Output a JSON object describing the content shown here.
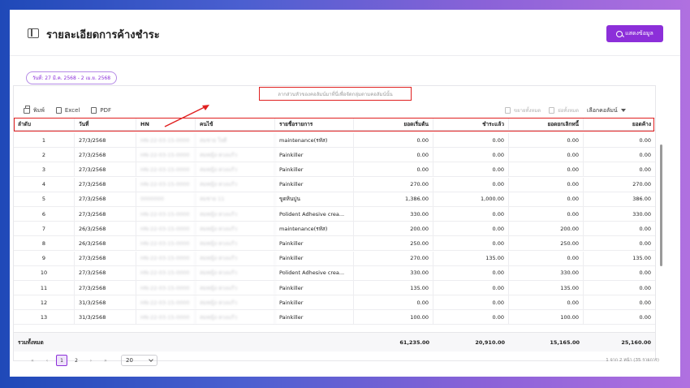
{
  "header": {
    "title": "รายละเอียดการค้างชำระ",
    "show_button": "แสดงข้อมูล"
  },
  "date_range": "วันที่: 27 มี.ค. 2568 - 2 เม.ย. 2568",
  "group_hint": "ลากส่วนหัวของคอลัมน์มาที่นี่เพื่อจัดกลุ่มตามคอลัมน์นั้น",
  "toolbar": {
    "print": "พิมพ์",
    "excel": "Excel",
    "pdf": "PDF",
    "expand_all": "ขยายทั้งหมด",
    "collapse_all": "ย่อทั้งหมด",
    "choose_columns": "เลือกคอลัมน์"
  },
  "columns": [
    "ลำดับ",
    "วันที่",
    "HN",
    "คนไข้",
    "รายชื่อรายการ",
    "ยอดเริ่มต้น",
    "ชำระแล้ว",
    "ยอดยกเลิกหนี้",
    "ยอดค้าง"
  ],
  "rows": [
    {
      "no": "1",
      "date": "27/3/2568",
      "hn": "HN-22-03-15-0000",
      "patient": "สมชาย ใจดี",
      "item": "maintenance(รหัส)",
      "start": "0.00",
      "paid": "0.00",
      "cancel": "0.00",
      "owed": "0.00"
    },
    {
      "no": "2",
      "date": "27/3/2568",
      "hn": "HN-22-03-15-0000",
      "patient": "สมหญิง ดวงแก้ว",
      "item": "Painkiller",
      "start": "0.00",
      "paid": "0.00",
      "cancel": "0.00",
      "owed": "0.00"
    },
    {
      "no": "3",
      "date": "27/3/2568",
      "hn": "HN-22-03-15-0000",
      "patient": "สมหญิง ดวงแก้ว",
      "item": "Painkiller",
      "start": "0.00",
      "paid": "0.00",
      "cancel": "0.00",
      "owed": "0.00"
    },
    {
      "no": "4",
      "date": "27/3/2568",
      "hn": "HN-22-03-15-0000",
      "patient": "สมหญิง ดวงแก้ว",
      "item": "Painkiller",
      "start": "270.00",
      "paid": "0.00",
      "cancel": "0.00",
      "owed": "270.00"
    },
    {
      "no": "5",
      "date": "27/3/2568",
      "hn": "0000000",
      "patient": "สมชาย 11",
      "item": "ขูดหินปูน",
      "start": "1,386.00",
      "paid": "1,000.00",
      "cancel": "0.00",
      "owed": "386.00"
    },
    {
      "no": "6",
      "date": "27/3/2568",
      "hn": "HN-22-03-15-0000",
      "patient": "สมหญิง ดวงแก้ว",
      "item": "Polident Adhesive crea...",
      "start": "330.00",
      "paid": "0.00",
      "cancel": "0.00",
      "owed": "330.00"
    },
    {
      "no": "7",
      "date": "26/3/2568",
      "hn": "HN-22-03-15-0000",
      "patient": "สมหญิง ดวงแก้ว",
      "item": "maintenance(รหัส)",
      "start": "200.00",
      "paid": "0.00",
      "cancel": "200.00",
      "owed": "0.00"
    },
    {
      "no": "8",
      "date": "26/3/2568",
      "hn": "HN-22-03-15-0000",
      "patient": "สมหญิง ดวงแก้ว",
      "item": "Painkiller",
      "start": "250.00",
      "paid": "0.00",
      "cancel": "250.00",
      "owed": "0.00"
    },
    {
      "no": "9",
      "date": "27/3/2568",
      "hn": "HN-22-03-15-0000",
      "patient": "สมหญิง ดวงแก้ว",
      "item": "Painkiller",
      "start": "270.00",
      "paid": "135.00",
      "cancel": "0.00",
      "owed": "135.00"
    },
    {
      "no": "10",
      "date": "27/3/2568",
      "hn": "HN-22-03-15-0000",
      "patient": "สมหญิง ดวงแก้ว",
      "item": "Polident Adhesive crea...",
      "start": "330.00",
      "paid": "0.00",
      "cancel": "330.00",
      "owed": "0.00"
    },
    {
      "no": "11",
      "date": "27/3/2568",
      "hn": "HN-22-03-15-0000",
      "patient": "สมหญิง ดวงแก้ว",
      "item": "Painkiller",
      "start": "135.00",
      "paid": "0.00",
      "cancel": "135.00",
      "owed": "0.00"
    },
    {
      "no": "12",
      "date": "31/3/2568",
      "hn": "HN-22-03-15-0000",
      "patient": "สมหญิง ดวงแก้ว",
      "item": "Painkiller",
      "start": "0.00",
      "paid": "0.00",
      "cancel": "0.00",
      "owed": "0.00"
    },
    {
      "no": "13",
      "date": "31/3/2568",
      "hn": "HN-22-03-15-0000",
      "patient": "สมหญิง ดวงแก้ว",
      "item": "Painkiller",
      "start": "100.00",
      "paid": "0.00",
      "cancel": "100.00",
      "owed": "0.00"
    }
  ],
  "totals": {
    "label": "รวมทั้งหมด",
    "start": "61,235.00",
    "paid": "20,910.00",
    "cancel": "15,165.00",
    "owed": "25,160.00"
  },
  "pagination": {
    "first": "«",
    "prev": "‹",
    "pages": [
      "1",
      "2"
    ],
    "next": "›",
    "last": "»",
    "page_size": "20",
    "info": "1 จาก 2 หน้า (35 รายการ)"
  },
  "colors": {
    "accent": "#8c2fd9",
    "highlight": "#e02020"
  }
}
